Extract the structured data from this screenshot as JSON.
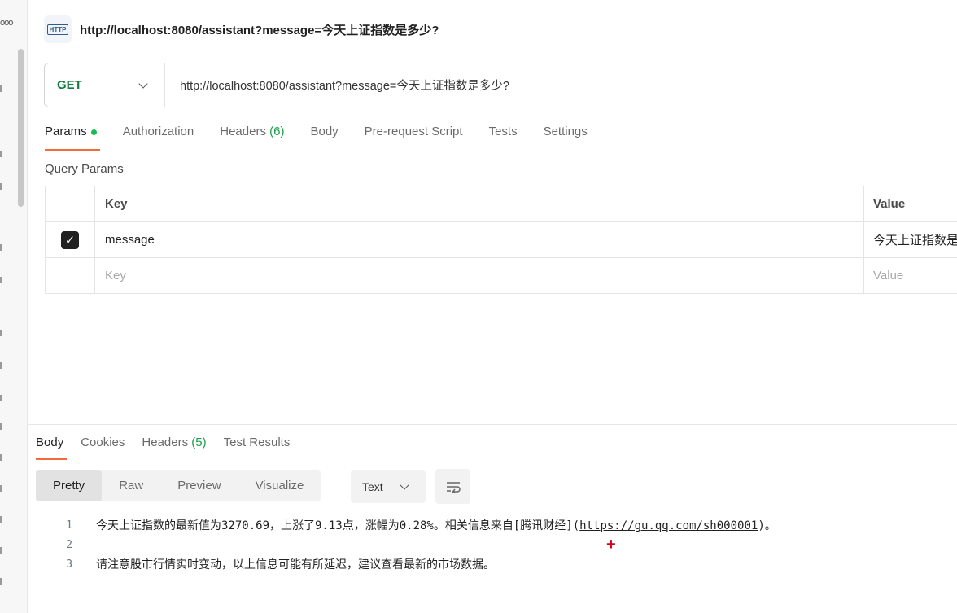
{
  "gutter": {
    "dots": "ooo"
  },
  "header": {
    "icon_label": "HTTP",
    "title": "http://localhost:8080/assistant?message=今天上证指数是多少?"
  },
  "request": {
    "method": "GET",
    "url": "http://localhost:8080/assistant?message=今天上证指数是多少?",
    "tabs": [
      {
        "label": "Params"
      },
      {
        "label": "Authorization"
      },
      {
        "label": "Headers",
        "count": "(6)"
      },
      {
        "label": "Body"
      },
      {
        "label": "Pre-request Script"
      },
      {
        "label": "Tests"
      },
      {
        "label": "Settings"
      }
    ],
    "query_params_title": "Query Params",
    "table": {
      "headers": [
        "Key",
        "Value"
      ],
      "rows": [
        {
          "checked": true,
          "key": "message",
          "value": "今天上证指数是"
        }
      ],
      "placeholder_key": "Key",
      "placeholder_value": "Value"
    }
  },
  "response": {
    "tabs": [
      {
        "label": "Body"
      },
      {
        "label": "Cookies"
      },
      {
        "label": "Headers",
        "count": "(5)"
      },
      {
        "label": "Test Results"
      }
    ],
    "views": [
      "Pretty",
      "Raw",
      "Preview",
      "Visualize"
    ],
    "format": "Text",
    "lines": [
      {
        "n": "1",
        "pre": "今天上证指数的最新值为3270.69，上涨了9.13点，涨幅为0.28%。相关信息来自[腾讯财经](",
        "link": "https://gu.qq.com/sh000001",
        "post": ")。"
      },
      {
        "n": "2",
        "pre": "",
        "link": "",
        "post": ""
      },
      {
        "n": "3",
        "pre": "请注意股市行情实时变动，以上信息可能有所延迟，建议查看最新的市场数据。",
        "link": "",
        "post": ""
      }
    ]
  },
  "colors": {
    "accent": "#f26b3a",
    "get_method": "#0f7b3f",
    "count": "#1a9e4a"
  }
}
